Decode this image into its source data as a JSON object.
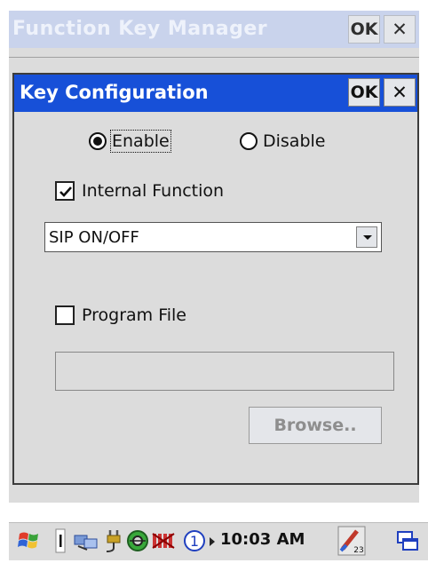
{
  "parent_window": {
    "title": "Function Key Manager",
    "ok_label": "OK",
    "close_label": "✕"
  },
  "dialog": {
    "title": "Key Configuration",
    "ok_label": "OK",
    "close_label": "✕",
    "radio_enable_label": "Enable",
    "radio_disable_label": "Disable",
    "radio_selected": "Enable",
    "internal_function_label": "Internal Function",
    "internal_function_checked": true,
    "function_select_value": "SIP ON/OFF",
    "program_file_label": "Program File",
    "program_file_checked": false,
    "program_file_value": "",
    "browse_label": "Browse.."
  },
  "taskbar": {
    "clock": "10:03 AM",
    "icons": [
      "start-flag-icon",
      "divider-icon",
      "connection-icon",
      "power-plug-icon",
      "sync-icon",
      "signal-off-icon",
      "channel-1-icon",
      "arrow-right-icon",
      "input-panel-icon",
      "desktop-icon"
    ],
    "channel_number": "1",
    "input_panel_number": "23"
  }
}
